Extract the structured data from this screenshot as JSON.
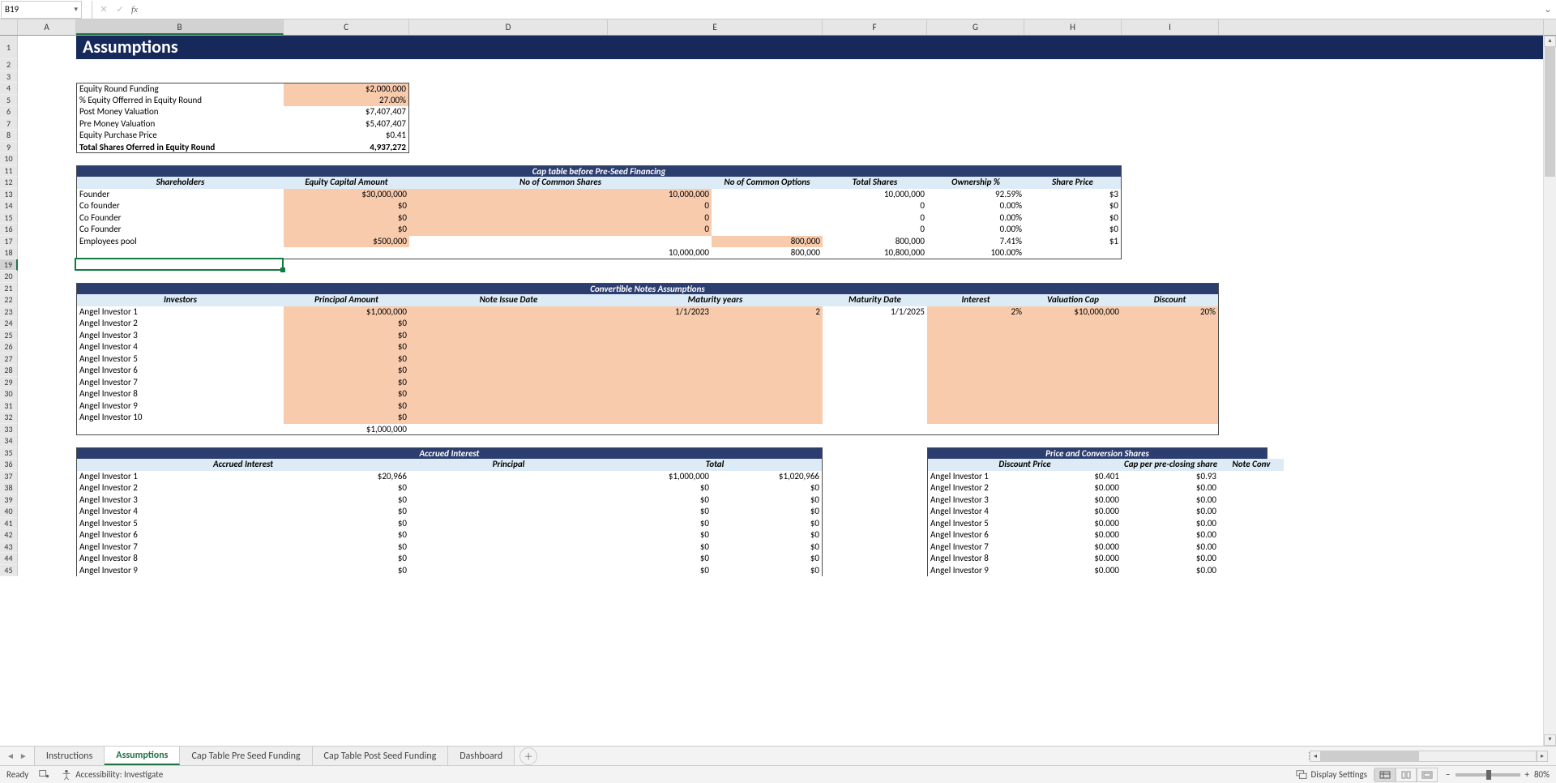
{
  "nameBox": "B19",
  "fxLabel": "fx",
  "formulaValue": "",
  "title": "Assumptions",
  "colLetters": [
    "A",
    "B",
    "C",
    "D",
    "E",
    "F",
    "G",
    "H",
    "I"
  ],
  "rowNums": [
    1,
    2,
    3,
    4,
    5,
    6,
    7,
    8,
    9,
    10,
    11,
    12,
    13,
    14,
    15,
    16,
    17,
    18,
    19,
    20,
    21,
    22,
    23,
    24,
    25,
    26,
    27,
    28,
    29,
    30,
    31,
    32,
    33,
    34,
    35,
    36,
    37,
    38,
    39,
    40,
    41,
    42,
    43,
    44,
    45
  ],
  "box": {
    "r4": {
      "b": "Equity Round Funding",
      "c": "$2,000,000"
    },
    "r5": {
      "b": "% Equity Offerred in Equity Round",
      "c": "27.00%"
    },
    "r6": {
      "b": "Post Money Valuation",
      "c": "$7,407,407"
    },
    "r7": {
      "b": "Pre Money Valuation",
      "c": "$5,407,407"
    },
    "r8": {
      "b": "Equity Purchase Price",
      "c": "$0.41"
    },
    "r9": {
      "b": "Total Shares Oferred in Equity Round",
      "c": "4,937,272"
    }
  },
  "tbl1": {
    "title": "Cap table before Pre-Seed Financing",
    "hdrs": {
      "b": "Shareholders",
      "c": "Equity Capital Amount",
      "d": "No of Common Shares",
      "e": "No of Common Options",
      "f": "Total Shares",
      "g": "Ownership %",
      "h": "Share Price"
    },
    "rows": [
      {
        "b": "Founder",
        "c": "$30,000,000",
        "d": "10,000,000",
        "e": "",
        "f": "10,000,000",
        "g": "92.59%",
        "h": "$3"
      },
      {
        "b": "Co founder",
        "c": "$0",
        "d": "0",
        "e": "",
        "f": "0",
        "g": "0.00%",
        "h": "$0"
      },
      {
        "b": "Co Founder",
        "c": "$0",
        "d": "0",
        "e": "",
        "f": "0",
        "g": "0.00%",
        "h": "$0"
      },
      {
        "b": "Co Founder",
        "c": "$0",
        "d": "0",
        "e": "",
        "f": "0",
        "g": "0.00%",
        "h": "$0"
      },
      {
        "b": "Employees pool",
        "c": "$500,000",
        "d": "",
        "e": "800,000",
        "f": "800,000",
        "g": "7.41%",
        "h": "$1"
      }
    ],
    "totals": {
      "d": "10,000,000",
      "e": "800,000",
      "f": "10,800,000",
      "g": "100.00%"
    }
  },
  "tbl2": {
    "title": "Convertible Notes Assumptions",
    "hdrs": {
      "b": "Investors",
      "c": "Principal Amount",
      "d": "Note Issue Date",
      "e": "Maturity years",
      "f": "Maturity Date",
      "g": "Interest",
      "h": "Valuation Cap",
      "i": "Discount"
    },
    "rows": [
      {
        "b": "Angel Investor 1",
        "c": "$1,000,000",
        "d": "1/1/2023",
        "e": "2",
        "f": "1/1/2025",
        "g": "2%",
        "h": "$10,000,000",
        "i": "20%"
      },
      {
        "b": "Angel Investor 2",
        "c": "$0",
        "d": "",
        "e": "",
        "f": "",
        "g": "",
        "h": "",
        "i": ""
      },
      {
        "b": "Angel Investor 3",
        "c": "$0",
        "d": "",
        "e": "",
        "f": "",
        "g": "",
        "h": "",
        "i": ""
      },
      {
        "b": "Angel Investor 4",
        "c": "$0",
        "d": "",
        "e": "",
        "f": "",
        "g": "",
        "h": "",
        "i": ""
      },
      {
        "b": "Angel Investor 5",
        "c": "$0",
        "d": "",
        "e": "",
        "f": "",
        "g": "",
        "h": "",
        "i": ""
      },
      {
        "b": "Angel Investor 6",
        "c": "$0",
        "d": "",
        "e": "",
        "f": "",
        "g": "",
        "h": "",
        "i": ""
      },
      {
        "b": "Angel Investor 7",
        "c": "$0",
        "d": "",
        "e": "",
        "f": "",
        "g": "",
        "h": "",
        "i": ""
      },
      {
        "b": "Angel Investor 8",
        "c": "$0",
        "d": "",
        "e": "",
        "f": "",
        "g": "",
        "h": "",
        "i": ""
      },
      {
        "b": "Angel Investor 9",
        "c": "$0",
        "d": "",
        "e": "",
        "f": "",
        "g": "",
        "h": "",
        "i": ""
      },
      {
        "b": "Angel Investor 10",
        "c": "$0",
        "d": "",
        "e": "",
        "f": "",
        "g": "",
        "h": "",
        "i": ""
      }
    ],
    "total": "$1,000,000"
  },
  "tbl3": {
    "title": "Accrued Interest",
    "hdrs": {
      "b": "Accrued Interest",
      "c": "Principal",
      "d": "Total"
    },
    "rows": [
      {
        "a": "Angel Investor 1",
        "b": "$20,966",
        "c": "$1,000,000",
        "d": "$1,020,966"
      },
      {
        "a": "Angel Investor 2",
        "b": "$0",
        "c": "$0",
        "d": "$0"
      },
      {
        "a": "Angel Investor 3",
        "b": "$0",
        "c": "$0",
        "d": "$0"
      },
      {
        "a": "Angel Investor 4",
        "b": "$0",
        "c": "$0",
        "d": "$0"
      },
      {
        "a": "Angel Investor 5",
        "b": "$0",
        "c": "$0",
        "d": "$0"
      },
      {
        "a": "Angel Investor 6",
        "b": "$0",
        "c": "$0",
        "d": "$0"
      },
      {
        "a": "Angel Investor 7",
        "b": "$0",
        "c": "$0",
        "d": "$0"
      },
      {
        "a": "Angel Investor 8",
        "b": "$0",
        "c": "$0",
        "d": "$0"
      },
      {
        "a": "Angel Investor 9",
        "b": "$0",
        "c": "$0",
        "d": "$0"
      }
    ]
  },
  "tbl4": {
    "title": "Price and Conversion Shares",
    "hdrs": {
      "a": "",
      "b": "Discount Price",
      "c": "Cap per pre-closing share",
      "d": "Note Conv"
    },
    "rows": [
      {
        "a": "Angel Investor 1",
        "b": "$0.401",
        "c": "$0.93"
      },
      {
        "a": "Angel Investor 2",
        "b": "$0.000",
        "c": "$0.00"
      },
      {
        "a": "Angel Investor 3",
        "b": "$0.000",
        "c": "$0.00"
      },
      {
        "a": "Angel Investor 4",
        "b": "$0.000",
        "c": "$0.00"
      },
      {
        "a": "Angel Investor 5",
        "b": "$0.000",
        "c": "$0.00"
      },
      {
        "a": "Angel Investor 6",
        "b": "$0.000",
        "c": "$0.00"
      },
      {
        "a": "Angel Investor 7",
        "b": "$0.000",
        "c": "$0.00"
      },
      {
        "a": "Angel Investor 8",
        "b": "$0.000",
        "c": "$0.00"
      },
      {
        "a": "Angel Investor 9",
        "b": "$0.000",
        "c": "$0.00"
      }
    ]
  },
  "tabs": [
    "Instructions",
    "Assumptions",
    "Cap Table Pre Seed Funding",
    "Cap Table Post Seed Funding",
    "Dashboard"
  ],
  "activeTab": 1,
  "status": {
    "ready": "Ready",
    "acc": "Accessibility: Investigate",
    "disp": "Display Settings",
    "zoom": "80%"
  },
  "chart_data": []
}
